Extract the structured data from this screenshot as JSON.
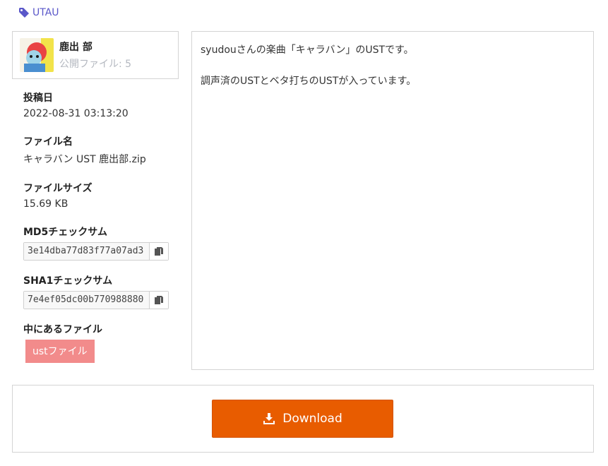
{
  "tag": {
    "label": "UTAU",
    "icon": "tag-icon"
  },
  "user": {
    "name": "鹿出 部",
    "public_files": "公開ファイル: 5",
    "avatar_icon": "avatar"
  },
  "meta": {
    "posted_label": "投稿日",
    "posted_value": "2022-08-31 03:13:20",
    "filename_label": "ファイル名",
    "filename_value": "キャラバン UST 鹿出部.zip",
    "filesize_label": "ファイルサイズ",
    "filesize_value": "15.69 KB",
    "md5_label": "MD5チェックサム",
    "md5_value": "3e14dba77d83f77a07ad3",
    "sha1_label": "SHA1チェックサム",
    "sha1_value": "7e4ef05dc00b770988880",
    "contents_label": "中にあるファイル",
    "contents_badge": "ustファイル"
  },
  "description": {
    "line1": "syudouさんの楽曲「キャラバン」のUSTです。",
    "line2": "調声済のUSTとベタ打ちのUSTが入っています。"
  },
  "download": {
    "label": "Download",
    "icon": "download-icon"
  },
  "colors": {
    "accent": "#5a57c9",
    "download": "#e85c00",
    "badge": "#f28b8b"
  }
}
